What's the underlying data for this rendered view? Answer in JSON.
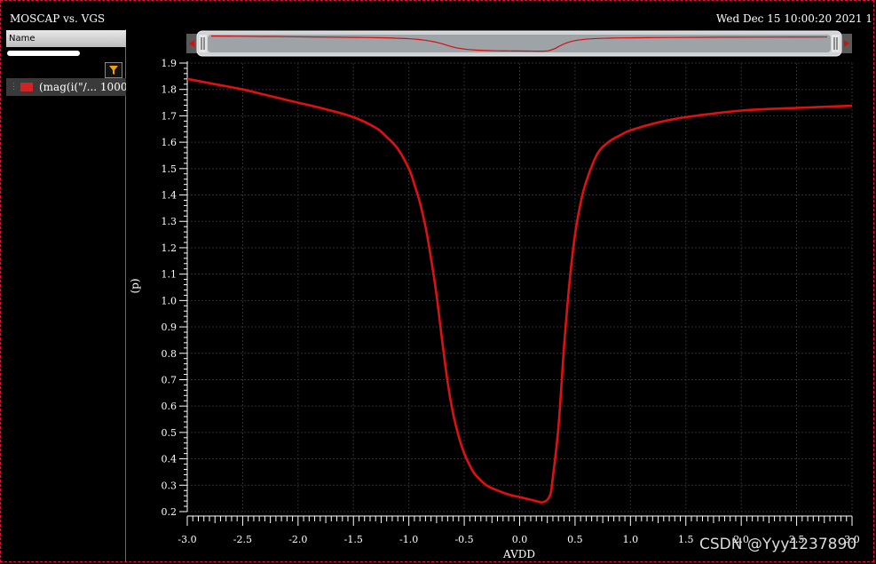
{
  "window": {
    "title": "MOSCAP vs. VGS",
    "datetime": "Wed Dec 15 10:00:20 2021  1"
  },
  "legend_panel": {
    "column_header": "Name",
    "items": [
      {
        "label": "(mag(i(\"/... 1000",
        "color": "#d32222"
      }
    ]
  },
  "watermark": "CSDN @Yyy1237890",
  "colors": {
    "background": "#000000",
    "trace": "#e01010",
    "grid": "#2e2e2e"
  },
  "chart_data": {
    "type": "line",
    "title": "MOSCAP vs. VGS",
    "xlabel": "AVDD",
    "ylabel": "(p)",
    "xlim": [
      -3.0,
      3.0
    ],
    "ylim": [
      0.2,
      1.9
    ],
    "xticks": [
      "-3.0",
      "-2.5",
      "-2.0",
      "-1.5",
      "-1.0",
      "-0.5",
      "0.0",
      "0.5",
      "1.0",
      "1.5",
      "2.0",
      "2.5",
      "3.0"
    ],
    "yticks": [
      "0.2",
      "0.3",
      "0.4",
      "0.5",
      "0.6",
      "0.7",
      "0.8",
      "0.9",
      "1.0",
      "1.1",
      "1.2",
      "1.3",
      "1.4",
      "1.5",
      "1.6",
      "1.7",
      "1.8",
      "1.9"
    ],
    "grid": true,
    "series": [
      {
        "color": "#e01010",
        "x": [
          -3.0,
          -2.75,
          -2.5,
          -2.25,
          -2.0,
          -1.75,
          -1.5,
          -1.3,
          -1.2,
          -1.1,
          -1.0,
          -0.95,
          -0.9,
          -0.85,
          -0.8,
          -0.75,
          -0.7,
          -0.65,
          -0.6,
          -0.55,
          -0.5,
          -0.45,
          -0.4,
          -0.3,
          -0.2,
          -0.1,
          0.0,
          0.1,
          0.15,
          0.2,
          0.25,
          0.28,
          0.3,
          0.35,
          0.4,
          0.45,
          0.5,
          0.55,
          0.6,
          0.7,
          0.8,
          0.9,
          1.0,
          1.25,
          1.5,
          2.0,
          2.5,
          3.0
        ],
        "y": [
          1.84,
          1.82,
          1.8,
          1.775,
          1.75,
          1.725,
          1.695,
          1.655,
          1.62,
          1.575,
          1.5,
          1.44,
          1.37,
          1.28,
          1.16,
          1.02,
          0.85,
          0.69,
          0.57,
          0.485,
          0.42,
          0.375,
          0.34,
          0.3,
          0.28,
          0.265,
          0.255,
          0.245,
          0.24,
          0.235,
          0.245,
          0.27,
          0.33,
          0.52,
          0.82,
          1.07,
          1.25,
          1.37,
          1.45,
          1.555,
          1.6,
          1.625,
          1.645,
          1.675,
          1.695,
          1.72,
          1.73,
          1.738
        ]
      }
    ],
    "overview_bar": {
      "handles": 2
    }
  }
}
